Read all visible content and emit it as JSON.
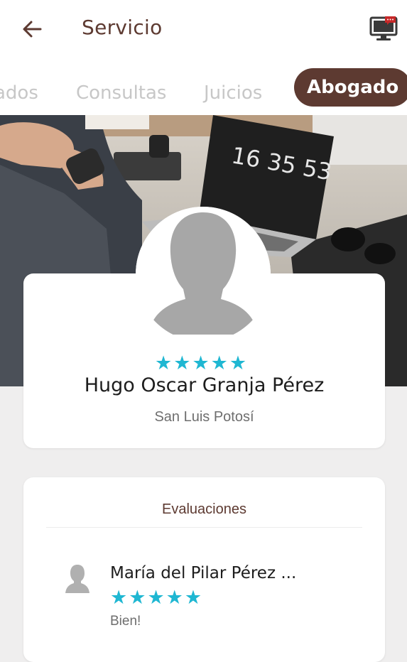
{
  "header": {
    "title": "Servicio",
    "back_icon": "arrow-left-icon",
    "action_icon": "monitor-chat-icon"
  },
  "tabs": [
    {
      "label": "ados",
      "active": false
    },
    {
      "label": "Consultas",
      "active": false
    },
    {
      "label": "Juicios",
      "active": false
    },
    {
      "label": "Abogado",
      "active": true
    }
  ],
  "hero": {
    "clock_text": "16 35 53"
  },
  "profile": {
    "name": "Hugo Oscar Granja Pérez",
    "location": "San Luis Potosí",
    "rating": 5,
    "rating_max": 5
  },
  "evaluations": {
    "title": "Evaluaciones",
    "items": [
      {
        "reviewer": "María del Pilar Pérez ...",
        "rating": 5,
        "comment": "Bien!"
      }
    ]
  },
  "colors": {
    "primary": "#5d3a31",
    "star": "#1fb7d2",
    "tab_inactive": "#c7c7c7",
    "background": "#efeeee"
  }
}
